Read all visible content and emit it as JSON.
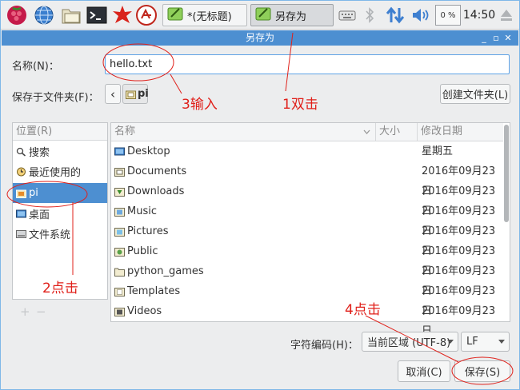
{
  "taskbar": {
    "tasks": [
      {
        "label": "*(无标题)",
        "icon": "text-editor-icon"
      },
      {
        "label": "另存为",
        "icon": "text-editor-icon"
      }
    ],
    "cpu_usage": "0 %",
    "clock": "14:50"
  },
  "window": {
    "title": "另存为"
  },
  "form": {
    "name_label": "名称(N)：",
    "name_value": "hello.txt",
    "folder_label": "保存于文件夹(F)：",
    "path_back": "‹",
    "path_current": "pi",
    "create_folder_button": "创建文件夹(L)"
  },
  "places": {
    "header": "位置(R)",
    "items": [
      {
        "label": "搜索",
        "icon": "search-icon"
      },
      {
        "label": "最近使用的",
        "icon": "clock-icon"
      },
      {
        "label": "pi",
        "icon": "home-folder-icon",
        "selected": true
      },
      {
        "label": "桌面",
        "icon": "desktop-icon"
      },
      {
        "label": "文件系统",
        "icon": "drive-icon"
      }
    ],
    "add": "+",
    "remove": "−"
  },
  "files": {
    "columns": {
      "name": "名称",
      "size": "大小",
      "modified": "修改日期"
    },
    "rows": [
      {
        "name": "Desktop",
        "date": "星期五",
        "icon": "desktop-folder-icon"
      },
      {
        "name": "Documents",
        "date": "2016年09月23日",
        "icon": "documents-folder-icon"
      },
      {
        "name": "Downloads",
        "date": "2016年09月23日",
        "icon": "downloads-folder-icon"
      },
      {
        "name": "Music",
        "date": "2016年09月23日",
        "icon": "music-folder-icon"
      },
      {
        "name": "Pictures",
        "date": "2016年09月23日",
        "icon": "pictures-folder-icon"
      },
      {
        "name": "Public",
        "date": "2016年09月23日",
        "icon": "public-folder-icon"
      },
      {
        "name": "python_games",
        "date": "2016年09月23日",
        "icon": "folder-icon"
      },
      {
        "name": "Templates",
        "date": "2016年09月23日",
        "icon": "templates-folder-icon"
      },
      {
        "name": "Videos",
        "date": "2016年09月23日",
        "icon": "videos-folder-icon"
      }
    ]
  },
  "encoding": {
    "label": "字符编码(H)：",
    "value": "当前区域 (UTF-8)",
    "line_ending": "LF"
  },
  "buttons": {
    "cancel": "取消(C)",
    "save": "保存(S)"
  },
  "annotations": {
    "step1": "1双击",
    "step2": "2点击",
    "step3": "3输入",
    "step4": "4点击"
  },
  "colors": {
    "accent": "#4d8fd1",
    "annotation": "#e0201a"
  }
}
